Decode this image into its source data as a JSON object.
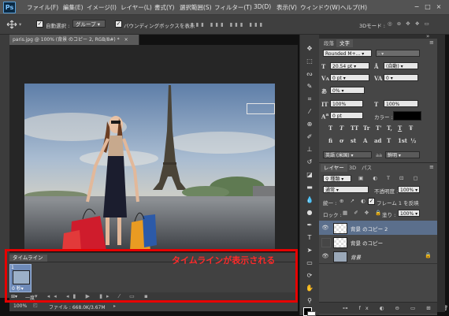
{
  "app": {
    "logo": "Ps"
  },
  "menu": [
    "ファイル(F)",
    "編集(E)",
    "イメージ(I)",
    "レイヤー(L)",
    "書式(Y)",
    "選択範囲(S)",
    "フィルター(T)",
    "3D(D)",
    "表示(V)",
    "ウィンドウ(W)",
    "ヘルプ(H)"
  ],
  "window_controls": [
    "−",
    "□",
    "×"
  ],
  "options_bar": {
    "auto_select_label": "自動選択 :",
    "auto_select_value": "グループ",
    "bbox_label": "バウンディングボックスを表示",
    "mode3d": "3Dモード :",
    "auto_select_checked": true,
    "bbox_checked": true
  },
  "document": {
    "tab_title": "paris.jpg @ 100% (背景 のコピー 2, RGB/8#) *",
    "close": "×"
  },
  "timeline": {
    "tab_label": "タイムライン",
    "frame_number": "1",
    "frame_delay": "0 秒▾",
    "loop_label": "一度"
  },
  "status": {
    "zoom": "100%",
    "file_info": "ファイル : 668.0K/3.67M"
  },
  "annotation": {
    "text": "タイムラインが表示される"
  },
  "character_panel": {
    "tabs": [
      "段落",
      "文字"
    ],
    "font_family": "Rounded M+...",
    "font_style": "-",
    "font_size": "20.54 pt",
    "leading": "(自動)",
    "kerning": "0 pt",
    "tracking": "0",
    "scale_pct": "0%",
    "vertical_scale": "100%",
    "horizontal_scale": "100%",
    "baseline": "0 pt",
    "color_label": "カラー :",
    "language": "英語 (米国)",
    "antialias": "鮮明",
    "type_buttons": [
      "T",
      "T",
      "TT",
      "Tr",
      "T'",
      "T,",
      "T",
      "Ŧ"
    ],
    "opentype_buttons": [
      "fi",
      "ơ",
      "st",
      "A",
      "ad",
      "T",
      "1st",
      "½"
    ]
  },
  "layers_panel": {
    "tabs": [
      "レイヤー",
      "3D",
      "パス"
    ],
    "filter": "種類",
    "blend_mode": "通常",
    "opacity_label": "不透明度 :",
    "opacity": "100%",
    "unify_label": "統一 :",
    "propagate_label": "フレーム 1 を反映",
    "lock_label": "ロック :",
    "fill_label": "塗り :",
    "fill": "100%",
    "layers": [
      {
        "name": "背景 のコピー 2",
        "selected": true,
        "visible": true
      },
      {
        "name": "背景 のコピー",
        "selected": false,
        "visible": false
      },
      {
        "name": "背景",
        "selected": false,
        "visible": true,
        "locked": true
      }
    ]
  }
}
